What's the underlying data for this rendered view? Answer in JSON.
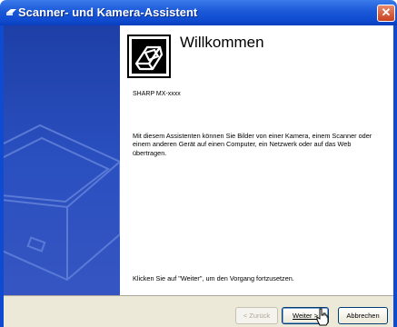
{
  "window": {
    "title": "Scanner- und Kamera-Assistent",
    "close_glyph": "✕"
  },
  "page": {
    "heading": "Willkommen",
    "device_name": "SHARP MX-xxxx",
    "description": "Mit diesem Assistenten können Sie Bilder von einer Kamera, einem Scanner oder einem anderen Gerät auf einen Computer, ein Netzwerk oder auf das Web übertragen.",
    "hint": "Klicken Sie auf \"Weiter\", um den Vorgang fortzusetzen."
  },
  "buttons": {
    "back_label": "< Zurück",
    "next_label": "Weiter >",
    "cancel_label": "Abbrechen",
    "back_enabled": false,
    "next_default": true
  },
  "icons": {
    "title": "scanner-camera-wizard-icon",
    "header": "camera-photo-icon",
    "sidebar": "scanner-illustration",
    "cursor": "hand-pointer-cursor"
  },
  "colors": {
    "titlebar": "#0f4bd0",
    "sidebar": "#2a4fbf",
    "footer": "#ece9d8",
    "close_button": "#c8411f"
  }
}
